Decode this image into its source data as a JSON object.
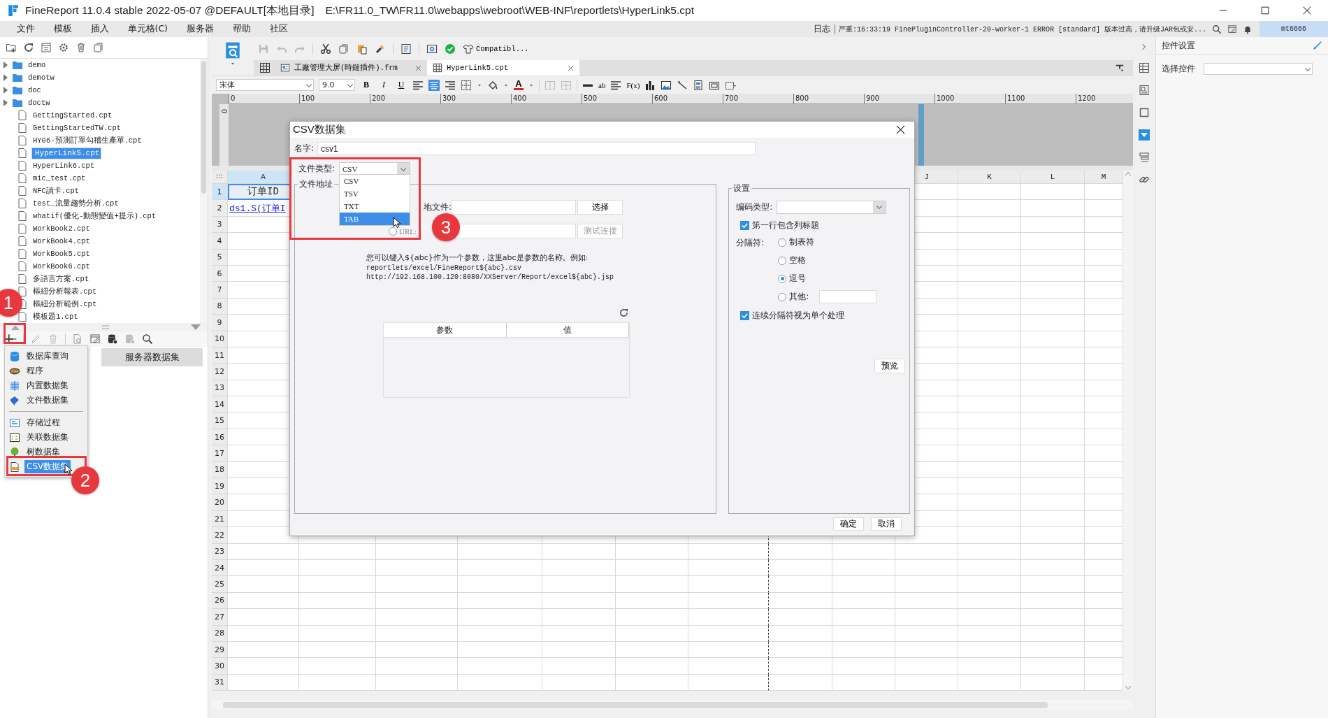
{
  "window": {
    "title": "FineReport 11.0.4 stable 2022-05-07 @DEFAULT[本地目录]",
    "path": "E:\\FR11.0_TW\\FR11.0\\webapps\\webroot\\WEB-INF\\reportlets\\HyperLink5.cpt"
  },
  "menu": [
    "文件",
    "模板",
    "插入",
    "单元格(C)",
    "服务器",
    "帮助",
    "社区"
  ],
  "log": {
    "label": "日志",
    "message": "严重:16:33:19 FinePluginController-20-worker-1 ERROR [standard] 版本过高，请升级JAR包或安..."
  },
  "user": "mt6666",
  "file_tree": [
    {
      "name": "demo",
      "kind": "folder",
      "expanded": false,
      "selected": false
    },
    {
      "name": "demotw",
      "kind": "folder",
      "expanded": false,
      "selected": false
    },
    {
      "name": "doc",
      "kind": "folder",
      "expanded": false,
      "selected": false
    },
    {
      "name": "doctw",
      "kind": "folder",
      "expanded": false,
      "selected": false
    },
    {
      "name": "GettingStarted.cpt",
      "kind": "file",
      "selected": false
    },
    {
      "name": "GettingStartedTW.cpt",
      "kind": "file",
      "selected": false
    },
    {
      "name": "HY06-預測訂單勾稽生產單.cpt",
      "kind": "file",
      "selected": false
    },
    {
      "name": "HyperLink5.cpt",
      "kind": "file",
      "selected": true
    },
    {
      "name": "HyperLink6.cpt",
      "kind": "file",
      "selected": false
    },
    {
      "name": "mic_test.cpt",
      "kind": "file",
      "selected": false
    },
    {
      "name": "NFC讀卡.cpt",
      "kind": "file",
      "selected": false
    },
    {
      "name": "test_流量趨勢分析.cpt",
      "kind": "file",
      "selected": false
    },
    {
      "name": "whatif(優化-動態變值+提示).cpt",
      "kind": "file",
      "selected": false
    },
    {
      "name": "WorkBook2.cpt",
      "kind": "file",
      "selected": false
    },
    {
      "name": "WorkBook4.cpt",
      "kind": "file",
      "selected": false
    },
    {
      "name": "WorkBook5.cpt",
      "kind": "file",
      "selected": false
    },
    {
      "name": "WorkBook6.cpt",
      "kind": "file",
      "selected": false
    },
    {
      "name": "多語言方案.cpt",
      "kind": "file",
      "selected": false
    },
    {
      "name": "樞紐分析報表.cpt",
      "kind": "file",
      "selected": false
    },
    {
      "name": "樞紐分析範例.cpt",
      "kind": "file",
      "selected": false
    },
    {
      "name": "模板題1.cpt",
      "kind": "file",
      "selected": false
    }
  ],
  "dataset_tab": "服务器数据集",
  "add_menu": [
    [
      {
        "label": "数据库查询",
        "kind": "database",
        "selected": false
      },
      {
        "label": "程序",
        "kind": "program",
        "selected": false
      },
      {
        "label": "内置数据集",
        "kind": "builtin",
        "selected": false
      },
      {
        "label": "文件数据集",
        "kind": "file",
        "selected": false
      }
    ],
    [
      {
        "label": "存储过程",
        "kind": "procedure",
        "selected": false
      },
      {
        "label": "关联数据集",
        "kind": "relation",
        "selected": false
      },
      {
        "label": "树数据集",
        "kind": "tree",
        "selected": false
      },
      {
        "label": "CSV数据集",
        "kind": "csv",
        "selected": true
      }
    ]
  ],
  "toolbar": {
    "compat_button": "Compatibl..."
  },
  "editor_tabs": [
    {
      "label": "工廠管理大屏(時鏈插件).frm",
      "selected": false
    },
    {
      "label": "HyperLink5.cpt",
      "selected": true
    }
  ],
  "format_bar": {
    "font": "宋体",
    "size": "9.0",
    "style_buttons": [
      "B",
      "I",
      "U"
    ],
    "font_color": "A",
    "text_buttons": [
      "ab",
      "F(x)"
    ]
  },
  "ruler": {
    "marks": [
      "0",
      "100",
      "200",
      "300",
      "400",
      "500",
      "600",
      "700",
      "800",
      "900",
      "1000",
      "1100",
      "1200"
    ],
    "vertical": "0"
  },
  "sheet": {
    "column_headers": [
      "A",
      "J",
      "K",
      "L",
      "M"
    ],
    "row_numbers": [
      "1",
      "2",
      "3",
      "4",
      "5",
      "6",
      "7",
      "8",
      "9",
      "10",
      "11",
      "12",
      "13",
      "14",
      "15",
      "16",
      "17",
      "18",
      "19",
      "20",
      "21",
      "22",
      "23",
      "24",
      "25",
      "26",
      "27",
      "28",
      "29",
      "30",
      "31"
    ],
    "cells": [
      {
        "text": "订单ID",
        "kind": "text",
        "selected": true
      },
      {
        "text": "ds1.S(订单I",
        "kind": "link",
        "selected": false
      }
    ]
  },
  "right_panel": {
    "title": "控件设置",
    "label": "选择控件"
  },
  "dialog": {
    "title": "CSV数据集",
    "name_label": "名字:",
    "name_value": "csv1",
    "type_label": "文件类型:",
    "type_value": "CSV",
    "type_options": [
      {
        "label": "CSV",
        "selected": false
      },
      {
        "label": "TSV",
        "selected": false
      },
      {
        "label": "TXT",
        "selected": false
      },
      {
        "label": "TAB",
        "selected": true
      }
    ],
    "address_legend": "文件地址",
    "local_label": "地文件:",
    "choose_button": "选择",
    "url_label": "URL:",
    "url_selected": false,
    "test_button": {
      "label": "测试连接",
      "disabled": true
    },
    "help": [
      "您可以键入${abc}作为一个参数，这里abc是参数的名称。例如:",
      "reportlets/excel/FineReport${abc}.csv",
      "http://192.168.100.120:8080/XXServer/Report/excel${abc}.jsp"
    ],
    "param_columns": [
      "参数",
      "值"
    ],
    "settings": {
      "legend": "设置",
      "encoding_label": "编码类型:",
      "first_row": {
        "label": "第一行包含列标题",
        "checked": true
      },
      "separator_label": "分隔符:",
      "separators": [
        {
          "label": "制表符",
          "selected": false
        },
        {
          "label": "空格",
          "selected": false
        },
        {
          "label": "逗号",
          "selected": true
        },
        {
          "label": "其他:",
          "selected": false
        }
      ],
      "merge": {
        "label": "连续分隔符视为单个处理",
        "checked": true
      },
      "preview": "预览"
    },
    "buttons": [
      "确定",
      "取消"
    ]
  },
  "annotations": [
    "1",
    "2",
    "3"
  ]
}
